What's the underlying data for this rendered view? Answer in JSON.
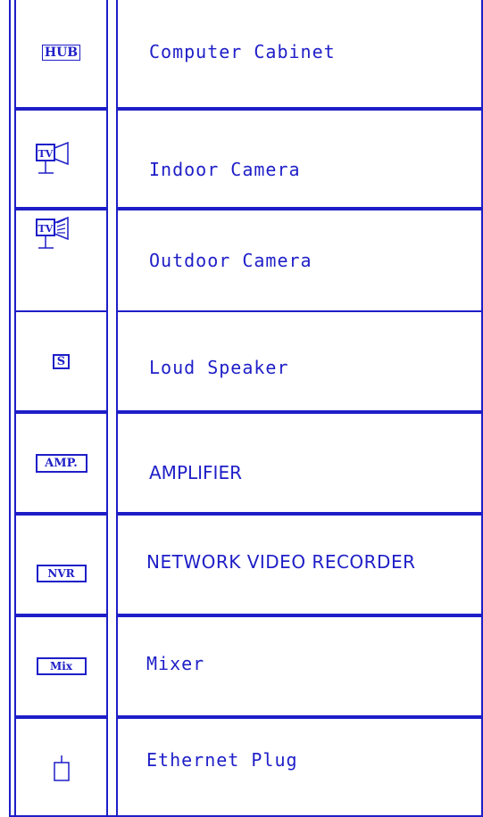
{
  "legend": {
    "rows": [
      {
        "symbol": {
          "name": "hub-symbol",
          "label": "HUB"
        },
        "description": "Computer Cabinet"
      },
      {
        "symbol": {
          "name": "indoor-camera-symbol",
          "label": "TV"
        },
        "description": "Indoor Camera"
      },
      {
        "symbol": {
          "name": "outdoor-camera-symbol",
          "label": "TV"
        },
        "description": "Outdoor Camera"
      },
      {
        "symbol": {
          "name": "speaker-symbol",
          "label": "S"
        },
        "description": "Loud Speaker"
      },
      {
        "symbol": {
          "name": "amplifier-symbol",
          "label": "AMP."
        },
        "description": "AMPLIFIER"
      },
      {
        "symbol": {
          "name": "nvr-symbol",
          "label": "NVR"
        },
        "description": "NETWORK VIDEO RECORDER"
      },
      {
        "symbol": {
          "name": "mixer-symbol",
          "label": "Mix"
        },
        "description": "Mixer"
      },
      {
        "symbol": {
          "name": "ethernet-plug-symbol",
          "label": ""
        },
        "description": "Ethernet Plug"
      }
    ]
  },
  "colors": {
    "line": "#1e1ec8",
    "background": "#ffffff"
  }
}
